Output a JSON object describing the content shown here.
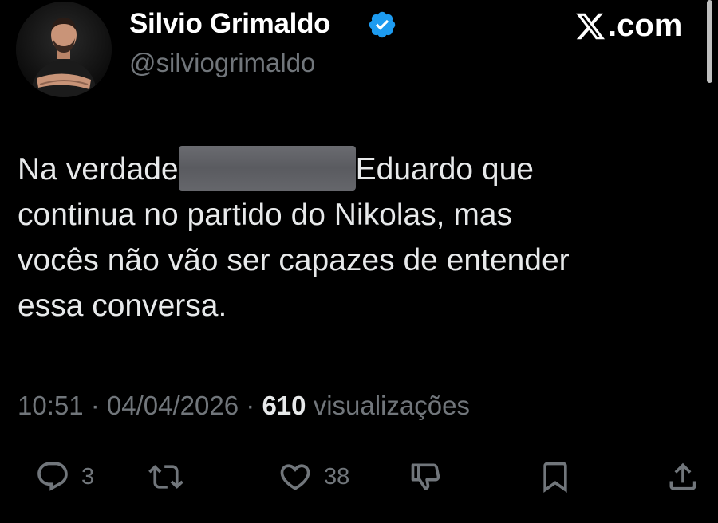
{
  "author": {
    "display_name": "Silvio Grimaldo",
    "handle": "@silviogrimaldo",
    "verified_icon": "verified-badge-icon",
    "verified_color": "#1d9bf0"
  },
  "brand": {
    "label": ".com",
    "icon": "x-logo-icon"
  },
  "tweet": {
    "line1_before": "Na verdade",
    "line1_after": "Eduardo que",
    "line2": "continua no partido do Nikolas, mas",
    "line3": "vocês não vão ser capazes de entender",
    "line4": "essa conversa."
  },
  "meta": {
    "time": "10:51",
    "date": "04/04/2026",
    "separator": "·",
    "views_count": "610",
    "views_label": "visualizações"
  },
  "actions": {
    "reply": {
      "icon": "reply-icon",
      "count": "3"
    },
    "repost": {
      "icon": "repost-icon"
    },
    "like": {
      "icon": "heart-icon",
      "count": "38"
    },
    "dislike": {
      "icon": "thumbs-down-icon"
    },
    "bookmark": {
      "icon": "bookmark-icon"
    },
    "share": {
      "icon": "share-icon"
    }
  },
  "colors": {
    "background": "#000000",
    "primary_text": "#e7e9ea",
    "secondary_text": "#71767b",
    "accent": "#1d9bf0"
  }
}
